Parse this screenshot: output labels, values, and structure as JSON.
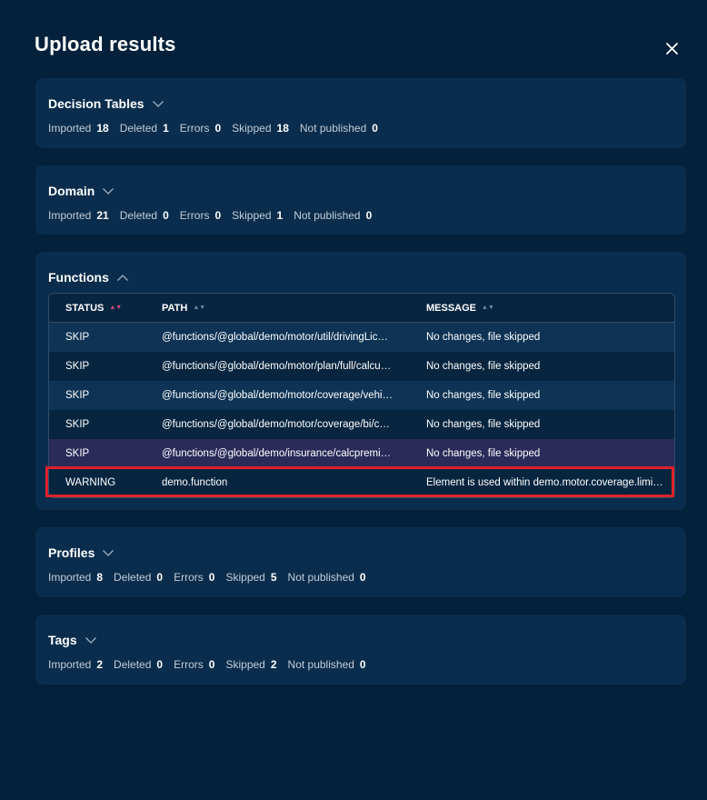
{
  "title": "Upload results",
  "sections": {
    "decision_tables": {
      "name": "Decision Tables",
      "stats": [
        {
          "label": "Imported",
          "value": "18"
        },
        {
          "label": "Deleted",
          "value": "1"
        },
        {
          "label": "Errors",
          "value": "0"
        },
        {
          "label": "Skipped",
          "value": "18"
        },
        {
          "label": "Not published",
          "value": "0"
        }
      ]
    },
    "domain": {
      "name": "Domain",
      "stats": [
        {
          "label": "Imported",
          "value": "21"
        },
        {
          "label": "Deleted",
          "value": "0"
        },
        {
          "label": "Errors",
          "value": "0"
        },
        {
          "label": "Skipped",
          "value": "1"
        },
        {
          "label": "Not published",
          "value": "0"
        }
      ]
    },
    "functions": {
      "name": "Functions",
      "columns": [
        "STATUS",
        "PATH",
        "MESSAGE"
      ],
      "rows": [
        {
          "status": "SKIP",
          "path": "@functions/@global/demo/motor/util/drivingLic…",
          "message": "No changes, file skipped"
        },
        {
          "status": "SKIP",
          "path": "@functions/@global/demo/motor/plan/full/calcu…",
          "message": "No changes, file skipped"
        },
        {
          "status": "SKIP",
          "path": "@functions/@global/demo/motor/coverage/vehi…",
          "message": "No changes, file skipped"
        },
        {
          "status": "SKIP",
          "path": "@functions/@global/demo/motor/coverage/bi/c…",
          "message": "No changes, file skipped"
        },
        {
          "status": "SKIP",
          "path": "@functions/@global/demo/insurance/calcpremi…",
          "message": "No changes, file skipped"
        },
        {
          "status": "WARNING",
          "path": "demo.function",
          "message": "Element is used within demo.motor.coverage.limi…"
        }
      ]
    },
    "profiles": {
      "name": "Profiles",
      "stats": [
        {
          "label": "Imported",
          "value": "8"
        },
        {
          "label": "Deleted",
          "value": "0"
        },
        {
          "label": "Errors",
          "value": "0"
        },
        {
          "label": "Skipped",
          "value": "5"
        },
        {
          "label": "Not published",
          "value": "0"
        }
      ]
    },
    "tags": {
      "name": "Tags",
      "stats": [
        {
          "label": "Imported",
          "value": "2"
        },
        {
          "label": "Deleted",
          "value": "0"
        },
        {
          "label": "Errors",
          "value": "0"
        },
        {
          "label": "Skipped",
          "value": "2"
        },
        {
          "label": "Not published",
          "value": "0"
        }
      ]
    }
  },
  "colors": {
    "background": "#03213a",
    "card": "#0a2d4d",
    "highlight_row": "#2b2b5a",
    "warning_outline": "#e0202a",
    "sort_active": "#d44a7a"
  }
}
